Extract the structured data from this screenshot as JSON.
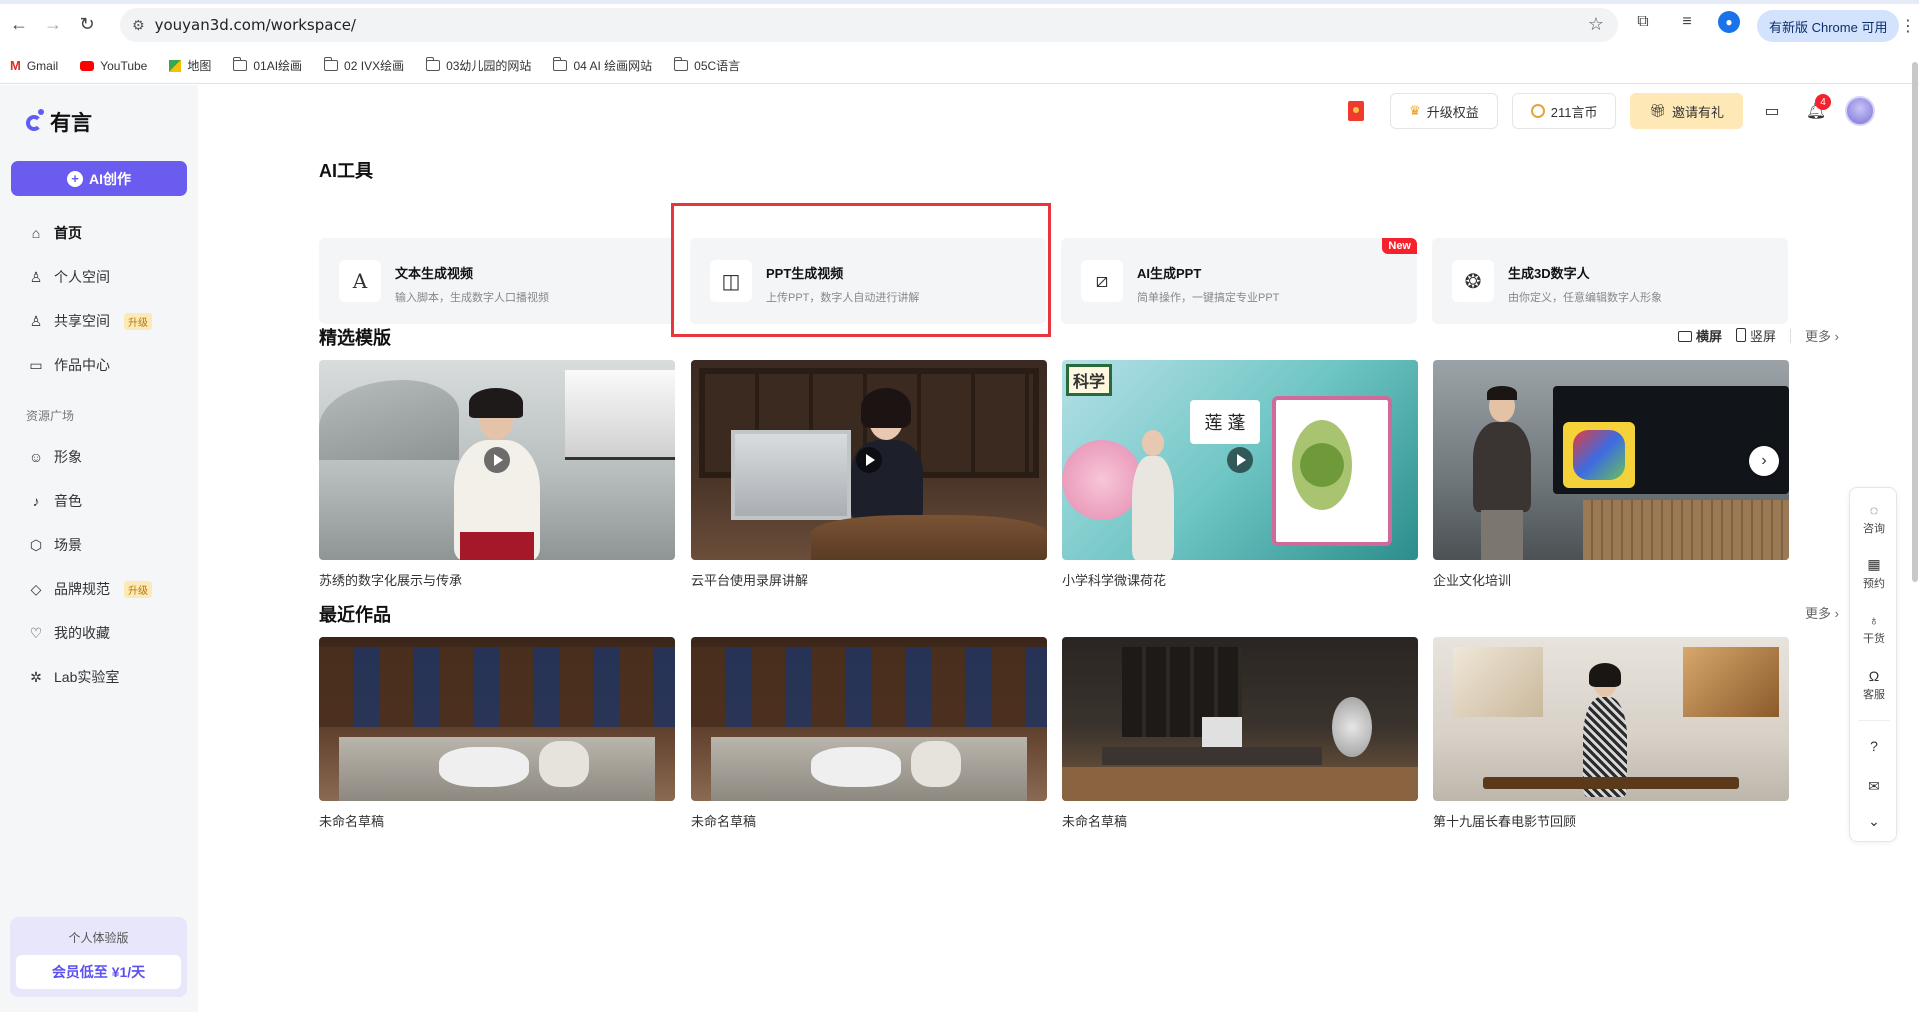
{
  "browser": {
    "url": "youyan3d.com/workspace/",
    "update_label": "有新版 Chrome 可用",
    "bookmarks": [
      {
        "label": "Gmail",
        "icon": "gmail-icon"
      },
      {
        "label": "YouTube",
        "icon": "youtube-icon"
      },
      {
        "label": "地图",
        "icon": "maps-icon"
      },
      {
        "label": "01AI绘画",
        "icon": "folder-icon"
      },
      {
        "label": "02 IVX绘画",
        "icon": "folder-icon"
      },
      {
        "label": "03幼儿园的网站",
        "icon": "folder-icon"
      },
      {
        "label": "04 AI 绘画网站",
        "icon": "folder-icon"
      },
      {
        "label": "05C语言",
        "icon": "folder-icon"
      }
    ]
  },
  "sidebar": {
    "logo": "有言",
    "ai_create": "AI创作",
    "items": [
      {
        "label": "首页",
        "icon": "home-icon"
      },
      {
        "label": "个人空间",
        "icon": "user-icon"
      },
      {
        "label": "共享空间",
        "icon": "users-icon",
        "tag": "升级"
      },
      {
        "label": "作品中心",
        "icon": "folder-icon"
      }
    ],
    "resource_label": "资源广场",
    "resources": [
      {
        "label": "形象",
        "icon": "face-icon"
      },
      {
        "label": "音色",
        "icon": "mic-icon"
      },
      {
        "label": "场景",
        "icon": "scene-icon"
      },
      {
        "label": "品牌规范",
        "icon": "diamond-icon",
        "tag": "升级"
      },
      {
        "label": "我的收藏",
        "icon": "heart-icon"
      },
      {
        "label": "Lab实验室",
        "icon": "lab-icon"
      }
    ],
    "trial": {
      "title": "个人体验版",
      "cta": "会员低至 ¥1/天"
    }
  },
  "topbar": {
    "upgrade": "升级权益",
    "coins": "211言币",
    "invite": "邀请有礼",
    "notifications": "4"
  },
  "ai_tools": {
    "title": "AI工具",
    "cards": [
      {
        "name": "文本生成视频",
        "desc": "输入脚本，生成数字人口播视频",
        "icon": "text-a-icon"
      },
      {
        "name": "PPT生成视频",
        "desc": "上传PPT，数字人自动进行讲解",
        "icon": "ppt-icon"
      },
      {
        "name": "AI生成PPT",
        "desc": "简单操作，一键搞定专业PPT",
        "icon": "edit-cursor-icon",
        "tag": "New"
      },
      {
        "name": "生成3D数字人",
        "desc": "由你定义，任意编辑数字人形象",
        "icon": "3d-avatar-icon"
      }
    ]
  },
  "templates": {
    "title": "精选模版",
    "landscape": "横屏",
    "portrait": "竖屏",
    "more": "更多",
    "items": [
      {
        "label": "苏绣的数字化展示与传承"
      },
      {
        "label": "云平台使用录屏讲解"
      },
      {
        "label": "小学科学微课荷花"
      },
      {
        "label": "企业文化培训"
      }
    ],
    "science_sign": "科学",
    "lotus_chars": "莲 蓬"
  },
  "recent": {
    "title": "最近作品",
    "more": "更多",
    "items": [
      {
        "label": "未命名草稿"
      },
      {
        "label": "未命名草稿"
      },
      {
        "label": "未命名草稿"
      },
      {
        "label": "第十九届长春电影节回顾"
      }
    ]
  },
  "float_bar": [
    {
      "label": "咨询",
      "icon": "chat-icon"
    },
    {
      "label": "预约",
      "icon": "calendar-icon"
    },
    {
      "label": "干货",
      "icon": "bulb-icon"
    },
    {
      "label": "客服",
      "icon": "headset-icon"
    }
  ],
  "colors": {
    "brand": "#6b5cf0",
    "highlight": "#e8353c",
    "badge": "#f5222d"
  }
}
